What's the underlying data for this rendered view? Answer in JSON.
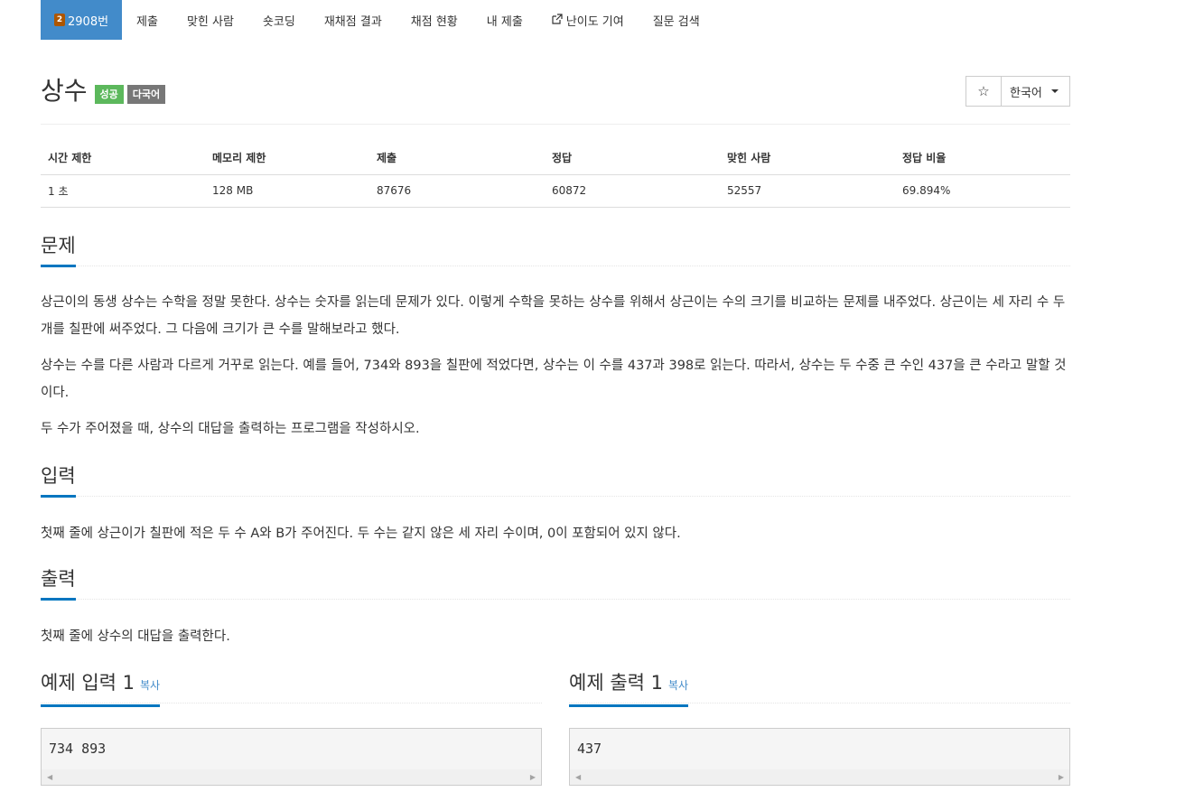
{
  "nav": {
    "problem_id": "2908번",
    "tier_badge": "2",
    "items": [
      "제출",
      "맞힌 사람",
      "숏코딩",
      "재채점 결과",
      "채점 현황",
      "내 제출",
      "난이도 기여",
      "질문 검색"
    ]
  },
  "problem": {
    "title": "상수",
    "label_success": "성공",
    "label_multilang": "다국어",
    "star": "☆",
    "language": "한국어"
  },
  "info": {
    "headers": [
      "시간 제한",
      "메모리 제한",
      "제출",
      "정답",
      "맞힌 사람",
      "정답 비율"
    ],
    "values": [
      "1 초",
      "128 MB",
      "87676",
      "60872",
      "52557",
      "69.894%"
    ]
  },
  "sections": {
    "description_title": "문제",
    "description": [
      "상근이의 동생 상수는 수학을 정말 못한다. 상수는 숫자를 읽는데 문제가 있다. 이렇게 수학을 못하는 상수를 위해서 상근이는 수의 크기를 비교하는 문제를 내주었다. 상근이는 세 자리 수 두 개를 칠판에 써주었다. 그 다음에 크기가 큰 수를 말해보라고 했다.",
      "상수는 수를 다른 사람과 다르게 거꾸로 읽는다. 예를 들어, 734와 893을 칠판에 적었다면, 상수는 이 수를 437과 398로 읽는다. 따라서, 상수는 두 수중 큰 수인 437을 큰 수라고 말할 것이다.",
      "두 수가 주어졌을 때, 상수의 대답을 출력하는 프로그램을 작성하시오."
    ],
    "input_title": "입력",
    "input": "첫째 줄에 상근이가 칠판에 적은 두 수 A와 B가 주어진다. 두 수는 같지 않은 세 자리 수이며, 0이 포함되어 있지 않다.",
    "output_title": "출력",
    "output": "첫째 줄에 상수의 대답을 출력한다."
  },
  "samples": {
    "input_title": "예제 입력 1",
    "output_title": "예제 출력 1",
    "copy_label": "복사",
    "input_value": "734 893",
    "output_value": "437"
  },
  "colors": {
    "accent": "#428bca",
    "success": "#5cb85c",
    "default_label": "#777777",
    "section_underline": "#0076c0"
  }
}
